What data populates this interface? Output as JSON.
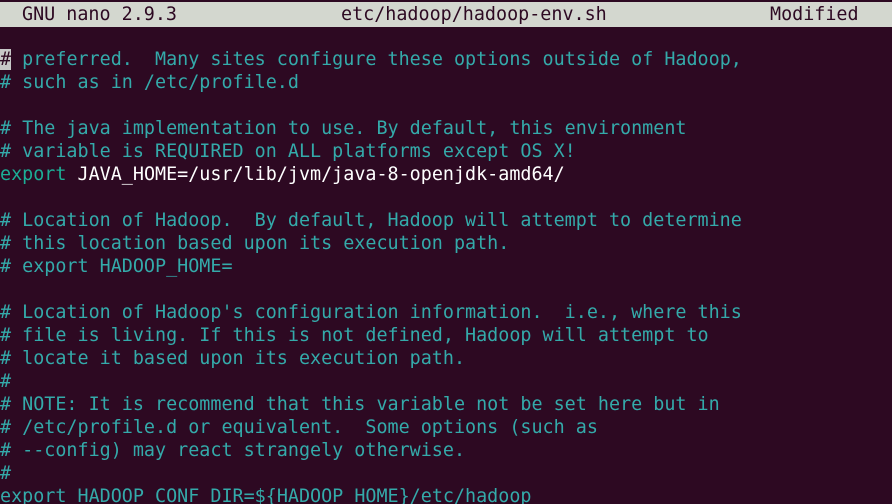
{
  "titlebar": {
    "app_name": "GNU nano 2.9.3",
    "file_path": "etc/hadoop/hadoop-env.sh",
    "status": "Modified"
  },
  "colors": {
    "background": "#2d0922",
    "titlebar_background": "#d3d7cf",
    "comment": "#34aaaa",
    "keyword": "#1cae96",
    "text": "#ffffff"
  },
  "editor": {
    "lines": [
      {
        "kind": "comment-cursor",
        "cursor_char": "#",
        "text": " preferred.  Many sites configure these options outside of Hadoop,"
      },
      {
        "kind": "comment",
        "text": "# such as in /etc/profile.d"
      },
      {
        "kind": "blank",
        "text": ""
      },
      {
        "kind": "comment",
        "text": "# The java implementation to use. By default, this environment"
      },
      {
        "kind": "comment",
        "text": "# variable is REQUIRED on ALL platforms except OS X!"
      },
      {
        "kind": "export",
        "keyword": "export",
        "name": " JAVA_HOME=",
        "value": "/usr/lib/jvm/java-8-openjdk-amd64/"
      },
      {
        "kind": "blank",
        "text": ""
      },
      {
        "kind": "comment",
        "text": "# Location of Hadoop.  By default, Hadoop will attempt to determine"
      },
      {
        "kind": "comment",
        "text": "# this location based upon its execution path."
      },
      {
        "kind": "comment",
        "text": "# export HADOOP_HOME="
      },
      {
        "kind": "blank",
        "text": ""
      },
      {
        "kind": "comment",
        "text": "# Location of Hadoop's configuration information.  i.e., where this"
      },
      {
        "kind": "comment",
        "text": "# file is living. If this is not defined, Hadoop will attempt to"
      },
      {
        "kind": "comment",
        "text": "# locate it based upon its execution path."
      },
      {
        "kind": "comment",
        "text": "#"
      },
      {
        "kind": "comment",
        "text": "# NOTE: It is recommend that this variable not be set here but in"
      },
      {
        "kind": "comment",
        "text": "# /etc/profile.d or equivalent.  Some options (such as"
      },
      {
        "kind": "comment",
        "text": "# --config) may react strangely otherwise."
      },
      {
        "kind": "comment",
        "text": "#"
      },
      {
        "kind": "export",
        "keyword": "export",
        "name": " HADOOP_CONF_DIR=",
        "value": "${HADOOP_HOME}/etc/hadoop"
      }
    ]
  }
}
